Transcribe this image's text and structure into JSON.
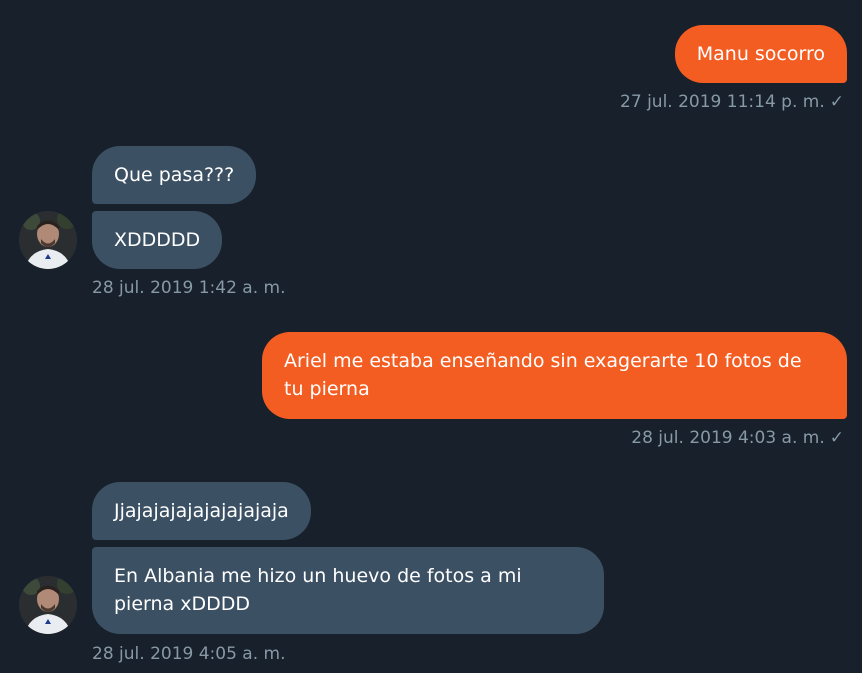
{
  "messages": [
    {
      "id": "m1",
      "direction": "outgoing",
      "text": "Manu socorro"
    },
    {
      "id": "m2",
      "direction": "incoming",
      "text": "Que pasa???"
    },
    {
      "id": "m3",
      "direction": "incoming",
      "text": "XDDDDD"
    },
    {
      "id": "m4",
      "direction": "outgoing",
      "text": "Ariel me estaba enseñando sin exagerarte 10 fotos de tu pierna"
    },
    {
      "id": "m5",
      "direction": "incoming",
      "text": "Jjajajajajajajajajaja"
    },
    {
      "id": "m6",
      "direction": "incoming",
      "text": "En Albania me hizo un huevo de fotos a mi pierna xDDDD"
    }
  ],
  "timestamps": {
    "t1": "27 jul. 2019 11:14 p. m.",
    "t2": "28 jul. 2019 1:42 a. m.",
    "t3": "28 jul. 2019 4:03 a. m.",
    "t4": "28 jul. 2019 4:05 a. m."
  },
  "status": {
    "sent_glyph": "✓"
  },
  "colors": {
    "background": "#17202b",
    "outgoing_bubble": "#f45d22",
    "incoming_bubble": "#3c5064",
    "meta_text": "#8899a6"
  },
  "icons": {
    "sent": "checkmark-icon",
    "avatar": "contact-avatar"
  }
}
